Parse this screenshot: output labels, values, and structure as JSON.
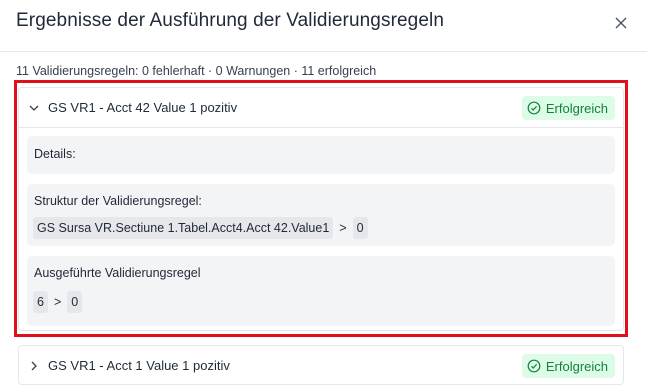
{
  "dialog": {
    "title": "Ergebnisse der Ausführung der Validierungsregeln",
    "summary": "11 Validierungsregeln: 0 fehlerhaft · 0 Warnungen · 11 erfolgreich"
  },
  "rules": [
    {
      "name": "GS VR1 - Acct 42 Value 1 pozitiv",
      "status": "Erfolgreich",
      "expanded": true,
      "details_label": "Details:",
      "structure_label": "Struktur der Validierungsregel:",
      "structure_left": "GS Sursa VR.Sectiune 1.Tabel.Acct4.Acct 42.Value1",
      "structure_operator": ">",
      "structure_right": "0",
      "executed_label": "Ausgeführte Validierungsregel",
      "executed_left": "6",
      "executed_operator": ">",
      "executed_right": "0"
    },
    {
      "name": "GS VR1 - Acct 1 Value 1 pozitiv",
      "status": "Erfolgreich",
      "expanded": false
    }
  ],
  "colors": {
    "success_bg": "#dcfce7",
    "success_text": "#15803d",
    "highlight_border": "#e0101a"
  },
  "icons": [
    "close-icon",
    "chevron-down-icon",
    "chevron-right-icon",
    "check-circle-icon"
  ]
}
